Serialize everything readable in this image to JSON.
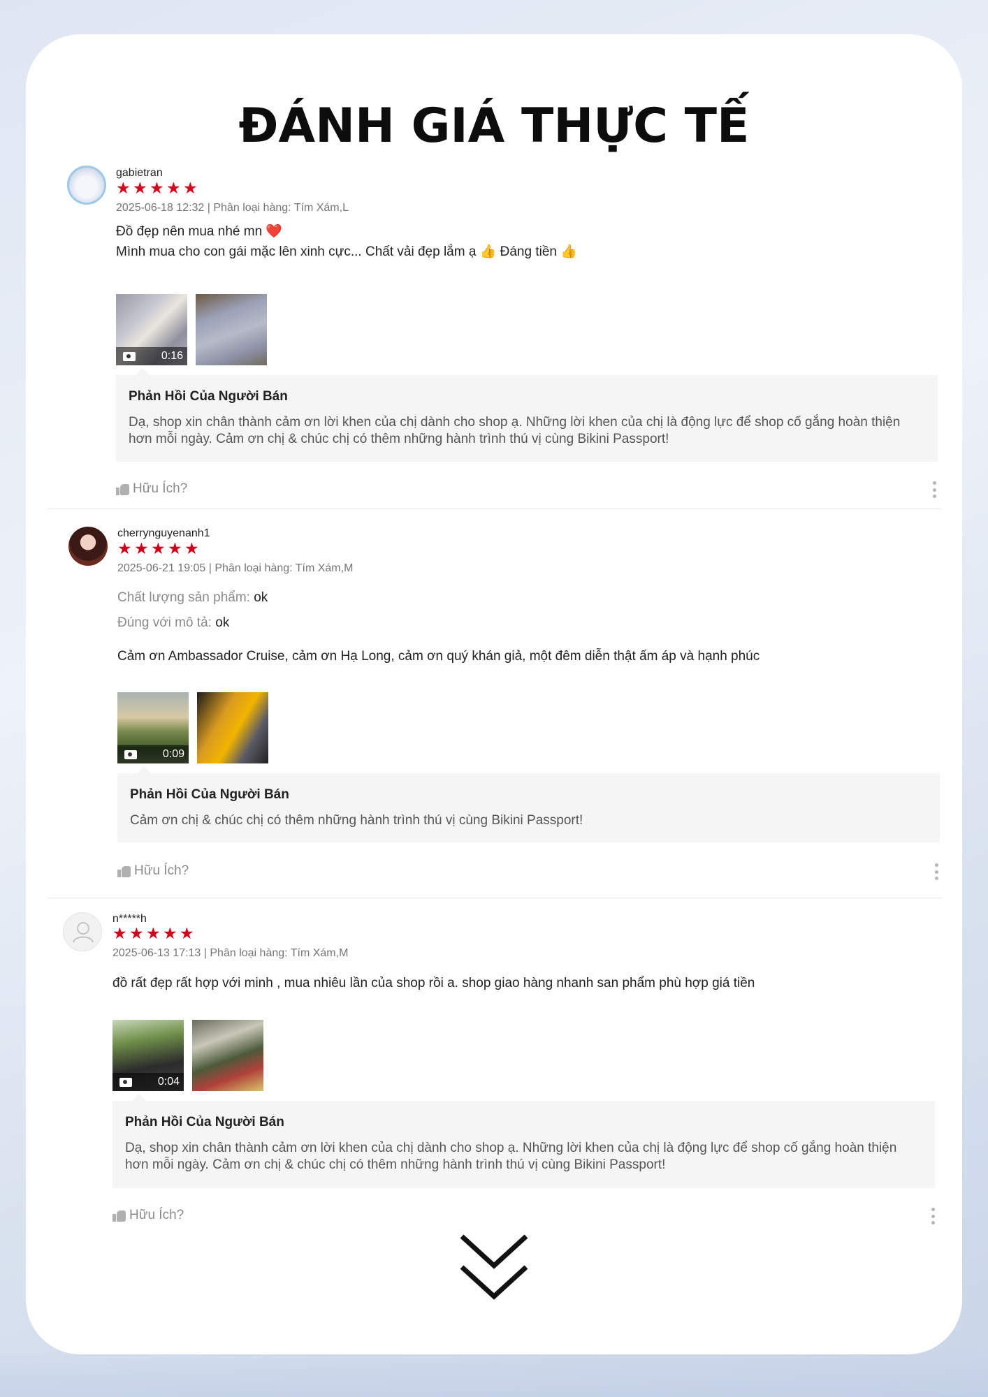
{
  "title": "ĐÁNH GIÁ THỰC TẾ",
  "reviews": [
    {
      "username": "gabietran",
      "rating": 5,
      "meta": "2025-06-18 12:32 | Phân loại hàng: Tím Xám,L",
      "content_lines": [
        "Đồ đẹp nên mua nhé mn ❤️",
        "Mình mua cho con gái mặc lên xinh cực... Chất vải đẹp lắm ạ 👍 Đáng tiền 👍"
      ],
      "video_duration": "0:16",
      "reply_title": "Phản Hồi Của Người Bán",
      "reply_text": "Dạ, shop xin chân thành cảm ơn lời khen của chị dành cho shop ạ. Những lời khen của chị là động lực để shop cố gắng hoàn thiện hơn mỗi ngày. Cảm ơn chị & chúc chị có thêm những hành trình thú vị cùng Bikini Passport!",
      "helpful_label": "Hữu Ích?"
    },
    {
      "username": "cherrynguyenanh1",
      "rating": 5,
      "meta": "2025-06-21 19:05 | Phân loại hàng: Tím Xám,M",
      "attributes": [
        {
          "label": "Chất lượng sản phẩm:",
          "value": "ok"
        },
        {
          "label": "Đúng với mô tả:",
          "value": "ok"
        }
      ],
      "content": "Cảm ơn Ambassador Cruise, cảm ơn Hạ Long, cảm ơn quý khán giả, một đêm diễn thật ấm áp và hạnh phúc",
      "video_duration": "0:09",
      "reply_title": "Phản Hồi Của Người Bán",
      "reply_text": "Cảm ơn chị & chúc chị có thêm những hành trình thú vị cùng Bikini Passport!",
      "helpful_label": "Hữu Ích?"
    },
    {
      "username": "n*****h",
      "rating": 5,
      "meta": "2025-06-13 17:13 | Phân loại hàng: Tím Xám,M",
      "content": "đồ rất đẹp rất hợp với minh , mua nhiêu lần của shop rồi a. shop giao hàng nhanh san phẩm phù hợp giá tiền",
      "video_duration": "0:04",
      "reply_title": "Phản Hồi Của Người Bán",
      "reply_text": "Dạ, shop xin chân thành cảm ơn lời khen của chị dành cho shop ạ. Những lời khen của chị là động lực để shop cố gắng hoàn thiện hơn mỗi ngày. Cảm ơn chị & chúc chị có thêm những hành trình thú vị cùng Bikini Passport!",
      "helpful_label": "Hữu Ích?"
    }
  ],
  "icons": {
    "star": "★",
    "scroll_more": "double-chevron-down-icon"
  },
  "colors": {
    "star": "#d0011b",
    "reply_bg": "#f5f5f5",
    "muted": "#757575"
  }
}
